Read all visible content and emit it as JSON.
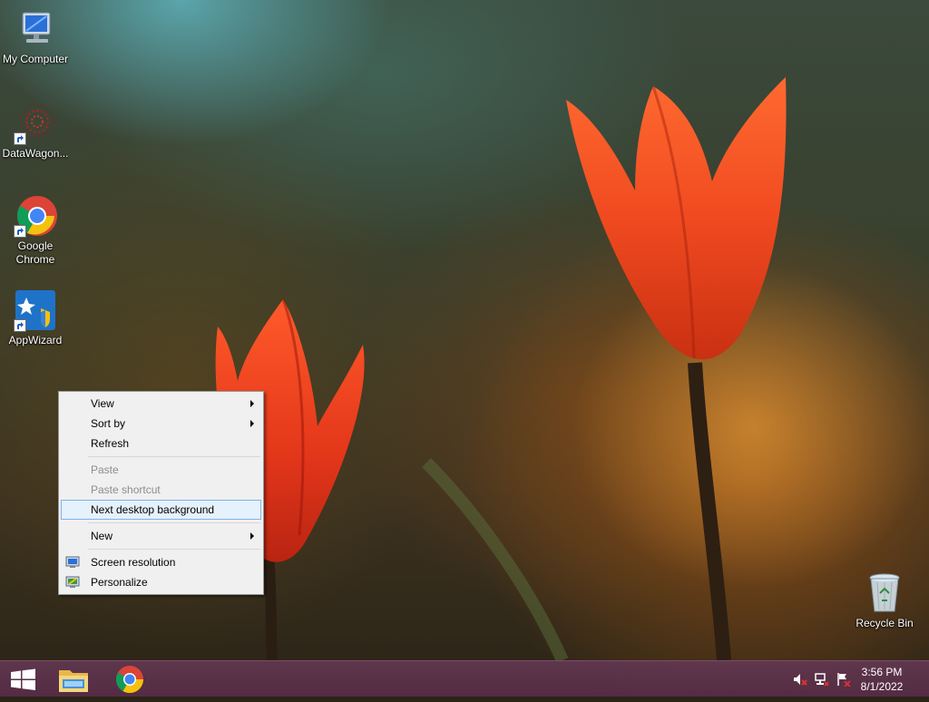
{
  "desktop": {
    "icons": [
      {
        "label": "My Computer",
        "icon": "computer-icon"
      },
      {
        "label": "DataWagon...",
        "icon": "datawagon-icon"
      },
      {
        "label": "Google Chrome",
        "icon": "chrome-icon"
      },
      {
        "label": "AppWizard",
        "icon": "appwizard-icon"
      },
      {
        "label": "Recycle Bin",
        "icon": "recycle-bin-icon"
      }
    ]
  },
  "context_menu": {
    "items": [
      {
        "label": "View",
        "submenu": true
      },
      {
        "label": "Sort by",
        "submenu": true
      },
      {
        "label": "Refresh"
      },
      {
        "label": "Paste",
        "disabled": true
      },
      {
        "label": "Paste shortcut",
        "disabled": true
      },
      {
        "label": "Next desktop background",
        "highlighted": true
      },
      {
        "label": "New",
        "submenu": true
      },
      {
        "label": "Screen resolution",
        "icon": "screen-resolution-icon"
      },
      {
        "label": "Personalize",
        "icon": "personalize-icon"
      }
    ]
  },
  "taskbar": {
    "buttons": [
      "start-icon",
      "file-explorer-icon",
      "chrome-icon"
    ],
    "tray": [
      "volume-muted-icon",
      "network-icon",
      "action-center-icon"
    ],
    "time": "3:56 PM",
    "date": "8/1/2022",
    "colors": {
      "taskbar": "#5e3550",
      "menu_highlight": "#e5f1fb"
    }
  }
}
